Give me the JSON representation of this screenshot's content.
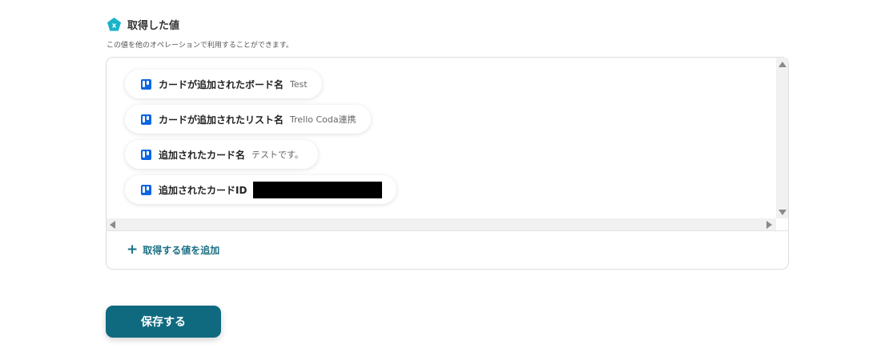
{
  "section": {
    "title": "取得した値",
    "description": "この値を他のオペレーションで利用することができます。"
  },
  "chips": [
    {
      "label": "カードが追加されたボード名",
      "value": "Test"
    },
    {
      "label": "カードが追加されたリスト名",
      "value": "Trello Coda連携"
    },
    {
      "label": "追加されたカード名",
      "value": "テストです。"
    },
    {
      "label": "追加されたカードID",
      "value": ""
    }
  ],
  "add_button": {
    "label": "取得する値を追加"
  },
  "save_button": {
    "label": "保存する"
  },
  "colors": {
    "accent": "#0f6a80",
    "trello": "#0c66e4",
    "pentagon": "#1ab3c9"
  }
}
